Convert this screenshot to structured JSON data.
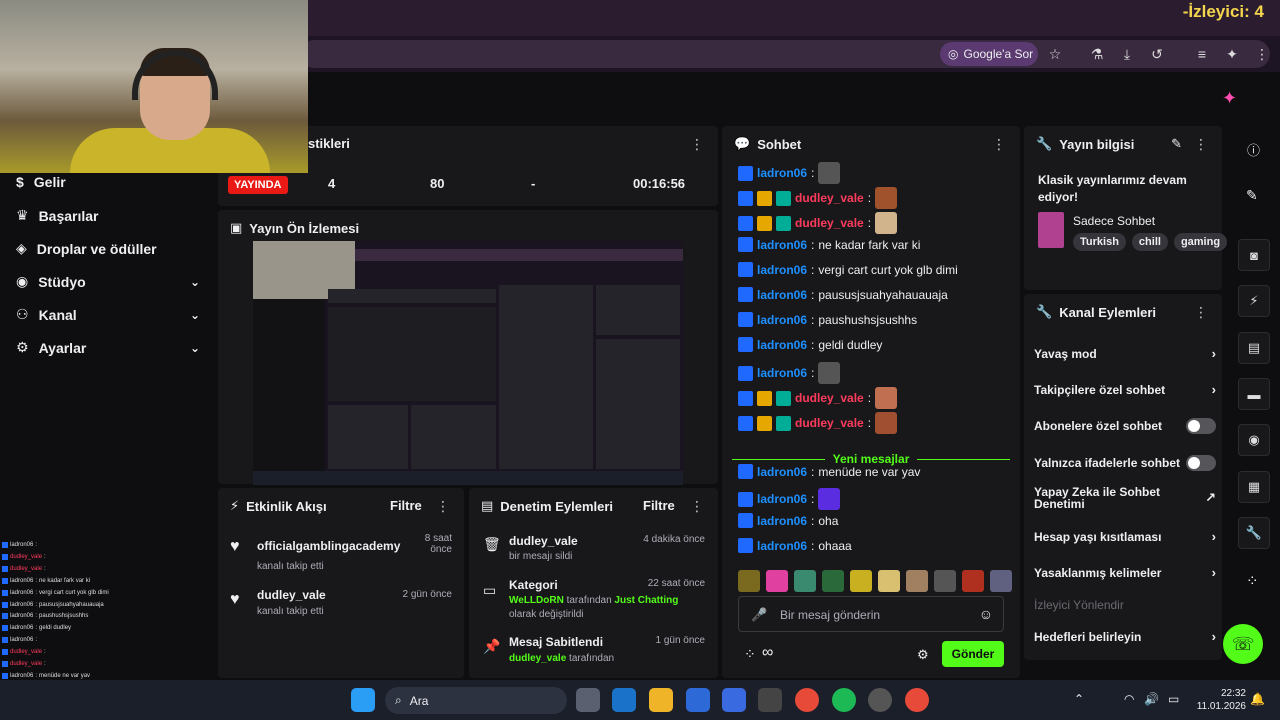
{
  "overlay": {
    "viewers": "-İzleyici: 4"
  },
  "browser": {
    "ask_google": "Google'a Sor"
  },
  "sidebar": {
    "items": [
      {
        "label": "Gelir",
        "icon": "dollar-icon",
        "chevron": false
      },
      {
        "label": "Başarılar",
        "icon": "trophy-icon",
        "chevron": false
      },
      {
        "label": "Droplar ve ödüller",
        "icon": "gift-icon",
        "chevron": false
      },
      {
        "label": "Stüdyo",
        "icon": "camera-icon",
        "chevron": true
      },
      {
        "label": "Kanal",
        "icon": "users-icon",
        "chevron": true
      },
      {
        "label": "Ayarlar",
        "icon": "gear-icon",
        "chevron": true
      }
    ]
  },
  "stats": {
    "title": "stikleri",
    "live": "YAYINDA",
    "viewers": "4",
    "followers": "80",
    "subs": "-",
    "uptime": "00:16:56"
  },
  "preview": {
    "title": "Yayın Ön İzlemesi"
  },
  "activity": {
    "title": "Etkinlik Akışı",
    "filter": "Filtre",
    "items": [
      {
        "name": "officialgamblingacademy",
        "desc": "kanalı takip etti",
        "time": "8 saat önce"
      },
      {
        "name": "dudley_vale",
        "desc": "kanalı takip etti",
        "time": "2 gün önce"
      }
    ]
  },
  "moderation": {
    "title": "Denetim Eylemleri",
    "filter": "Filtre",
    "items": [
      {
        "title": "dudley_vale",
        "desc": "bir mesajı sildi",
        "time": "4 dakika önce"
      },
      {
        "title": "Kategori",
        "user": "WeLLDoRN",
        "mid": "tarafından",
        "cat": "Just Chatting",
        "desc2": "olarak değiştirildi",
        "time": "22 saat önce"
      },
      {
        "title": "Mesaj Sabitlendi",
        "user": "dudley_vale",
        "mid": "tarafından",
        "time": "1 gün önce"
      }
    ]
  },
  "chat": {
    "title": "Sohbet",
    "new_messages": "Yeni mesajlar",
    "placeholder": "Bir mesaj gönderin",
    "send": "Gönder",
    "infinity": "∞",
    "lines": [
      {
        "user": "ladron06",
        "color": "u1",
        "text": "",
        "emote": "#555"
      },
      {
        "user": "dudley_vale",
        "color": "u2",
        "text": "",
        "emote": "#a0522d",
        "crown": true
      },
      {
        "user": "dudley_vale",
        "color": "u2",
        "text": "",
        "emote": "#d2b48c",
        "crown": true
      },
      {
        "user": "ladron06",
        "color": "u1",
        "text": "ne kadar fark var ki"
      },
      {
        "user": "ladron06",
        "color": "u1",
        "text": "vergi cart curt yok glb dimi"
      },
      {
        "user": "ladron06",
        "color": "u1",
        "text": "paususjsuahyahauauaja"
      },
      {
        "user": "ladron06",
        "color": "u1",
        "text": "paushushsjsushhs"
      },
      {
        "user": "ladron06",
        "color": "u1",
        "text": "geldi dudley"
      },
      {
        "user": "ladron06",
        "color": "u1",
        "text": "",
        "emote": "#555"
      },
      {
        "user": "dudley_vale",
        "color": "u2",
        "text": "",
        "emote": "#c07050",
        "crown": true
      },
      {
        "user": "dudley_vale",
        "color": "u2",
        "text": "",
        "emote": "#a05030",
        "crown": true
      },
      {
        "user": "ladron06",
        "color": "u1",
        "text": "menüde ne var yav"
      },
      {
        "user": "ladron06",
        "color": "u1",
        "text": "",
        "emote": "#5a2ee0"
      },
      {
        "user": "ladron06",
        "color": "u1",
        "text": "oha"
      },
      {
        "user": "ladron06",
        "color": "u1",
        "text": "ohaaa"
      }
    ]
  },
  "info": {
    "title": "Yayın bilgisi",
    "stream_title": "Klasik yayınlarımız devam ediyor!",
    "category": "Sadece Sohbet",
    "tags": [
      "Turkish",
      "chill",
      "gaming"
    ]
  },
  "actions": {
    "title": "Kanal Eylemleri",
    "items": [
      {
        "label": "Yavaş mod",
        "type": "chevron"
      },
      {
        "label": "Takipçilere özel sohbet",
        "type": "chevron"
      },
      {
        "label": "Abonelere özel sohbet",
        "type": "toggle"
      },
      {
        "label": "Yalnızca ifadelerle sohbet",
        "type": "toggle"
      },
      {
        "label": "Yapay Zeka ile Sohbet Denetimi",
        "type": "external"
      },
      {
        "label": "Hesap yaşı kısıtlaması",
        "type": "chevron"
      },
      {
        "label": "Yasaklanmış kelimeler",
        "type": "chevron"
      },
      {
        "label": "İzleyici Yönlendir",
        "type": "disabled"
      },
      {
        "label": "Hedefleri belirleyin",
        "type": "chevron"
      }
    ]
  },
  "taskbar": {
    "search": "Ara",
    "time": "22:32",
    "date": "11.01.2026"
  },
  "overlay_chat": [
    {
      "u": "ladron06",
      "t": ""
    },
    {
      "u": "dudley_vale",
      "t": ""
    },
    {
      "u": "dudley_vale",
      "t": ""
    },
    {
      "u": "ladron06",
      "t": "ne kadar fark var ki"
    },
    {
      "u": "ladron06",
      "t": "vergi cart curt yok glb dimi"
    },
    {
      "u": "ladron06",
      "t": "paususjsuahyahauauaja"
    },
    {
      "u": "ladron06",
      "t": "paushushsjsushhs"
    },
    {
      "u": "ladron06",
      "t": "geldi dudley"
    },
    {
      "u": "ladron06",
      "t": ""
    },
    {
      "u": "dudley_vale",
      "t": ""
    },
    {
      "u": "dudley_vale",
      "t": ""
    },
    {
      "u": "ladron06",
      "t": "menüde ne var yav"
    },
    {
      "u": "ladron06",
      "t": ""
    },
    {
      "u": "ladron06",
      "t": "oha"
    },
    {
      "u": "ladron06",
      "t": "ohaaa"
    }
  ]
}
